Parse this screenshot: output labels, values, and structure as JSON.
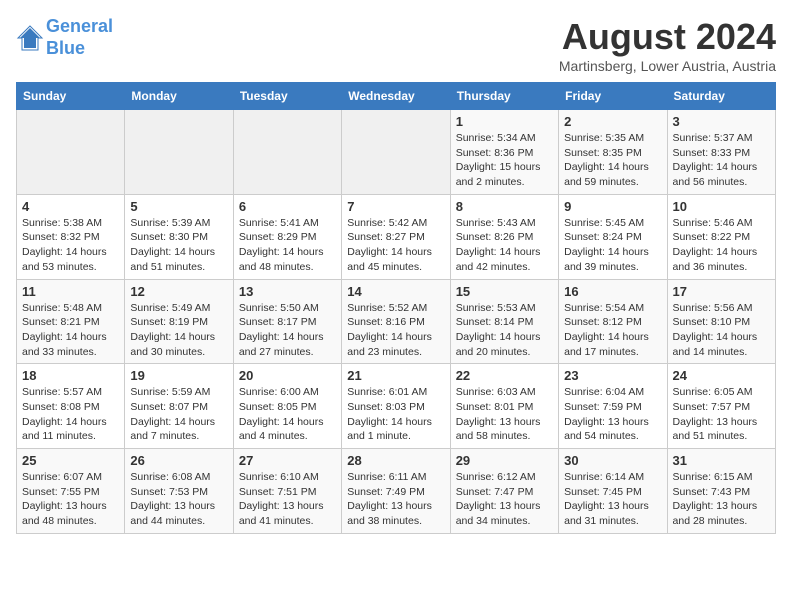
{
  "header": {
    "logo_line1": "General",
    "logo_line2": "Blue",
    "month_year": "August 2024",
    "location": "Martinsberg, Lower Austria, Austria"
  },
  "weekdays": [
    "Sunday",
    "Monday",
    "Tuesday",
    "Wednesday",
    "Thursday",
    "Friday",
    "Saturday"
  ],
  "weeks": [
    [
      {
        "day": "",
        "info": ""
      },
      {
        "day": "",
        "info": ""
      },
      {
        "day": "",
        "info": ""
      },
      {
        "day": "",
        "info": ""
      },
      {
        "day": "1",
        "info": "Sunrise: 5:34 AM\nSunset: 8:36 PM\nDaylight: 15 hours\nand 2 minutes."
      },
      {
        "day": "2",
        "info": "Sunrise: 5:35 AM\nSunset: 8:35 PM\nDaylight: 14 hours\nand 59 minutes."
      },
      {
        "day": "3",
        "info": "Sunrise: 5:37 AM\nSunset: 8:33 PM\nDaylight: 14 hours\nand 56 minutes."
      }
    ],
    [
      {
        "day": "4",
        "info": "Sunrise: 5:38 AM\nSunset: 8:32 PM\nDaylight: 14 hours\nand 53 minutes."
      },
      {
        "day": "5",
        "info": "Sunrise: 5:39 AM\nSunset: 8:30 PM\nDaylight: 14 hours\nand 51 minutes."
      },
      {
        "day": "6",
        "info": "Sunrise: 5:41 AM\nSunset: 8:29 PM\nDaylight: 14 hours\nand 48 minutes."
      },
      {
        "day": "7",
        "info": "Sunrise: 5:42 AM\nSunset: 8:27 PM\nDaylight: 14 hours\nand 45 minutes."
      },
      {
        "day": "8",
        "info": "Sunrise: 5:43 AM\nSunset: 8:26 PM\nDaylight: 14 hours\nand 42 minutes."
      },
      {
        "day": "9",
        "info": "Sunrise: 5:45 AM\nSunset: 8:24 PM\nDaylight: 14 hours\nand 39 minutes."
      },
      {
        "day": "10",
        "info": "Sunrise: 5:46 AM\nSunset: 8:22 PM\nDaylight: 14 hours\nand 36 minutes."
      }
    ],
    [
      {
        "day": "11",
        "info": "Sunrise: 5:48 AM\nSunset: 8:21 PM\nDaylight: 14 hours\nand 33 minutes."
      },
      {
        "day": "12",
        "info": "Sunrise: 5:49 AM\nSunset: 8:19 PM\nDaylight: 14 hours\nand 30 minutes."
      },
      {
        "day": "13",
        "info": "Sunrise: 5:50 AM\nSunset: 8:17 PM\nDaylight: 14 hours\nand 27 minutes."
      },
      {
        "day": "14",
        "info": "Sunrise: 5:52 AM\nSunset: 8:16 PM\nDaylight: 14 hours\nand 23 minutes."
      },
      {
        "day": "15",
        "info": "Sunrise: 5:53 AM\nSunset: 8:14 PM\nDaylight: 14 hours\nand 20 minutes."
      },
      {
        "day": "16",
        "info": "Sunrise: 5:54 AM\nSunset: 8:12 PM\nDaylight: 14 hours\nand 17 minutes."
      },
      {
        "day": "17",
        "info": "Sunrise: 5:56 AM\nSunset: 8:10 PM\nDaylight: 14 hours\nand 14 minutes."
      }
    ],
    [
      {
        "day": "18",
        "info": "Sunrise: 5:57 AM\nSunset: 8:08 PM\nDaylight: 14 hours\nand 11 minutes."
      },
      {
        "day": "19",
        "info": "Sunrise: 5:59 AM\nSunset: 8:07 PM\nDaylight: 14 hours\nand 7 minutes."
      },
      {
        "day": "20",
        "info": "Sunrise: 6:00 AM\nSunset: 8:05 PM\nDaylight: 14 hours\nand 4 minutes."
      },
      {
        "day": "21",
        "info": "Sunrise: 6:01 AM\nSunset: 8:03 PM\nDaylight: 14 hours\nand 1 minute."
      },
      {
        "day": "22",
        "info": "Sunrise: 6:03 AM\nSunset: 8:01 PM\nDaylight: 13 hours\nand 58 minutes."
      },
      {
        "day": "23",
        "info": "Sunrise: 6:04 AM\nSunset: 7:59 PM\nDaylight: 13 hours\nand 54 minutes."
      },
      {
        "day": "24",
        "info": "Sunrise: 6:05 AM\nSunset: 7:57 PM\nDaylight: 13 hours\nand 51 minutes."
      }
    ],
    [
      {
        "day": "25",
        "info": "Sunrise: 6:07 AM\nSunset: 7:55 PM\nDaylight: 13 hours\nand 48 minutes."
      },
      {
        "day": "26",
        "info": "Sunrise: 6:08 AM\nSunset: 7:53 PM\nDaylight: 13 hours\nand 44 minutes."
      },
      {
        "day": "27",
        "info": "Sunrise: 6:10 AM\nSunset: 7:51 PM\nDaylight: 13 hours\nand 41 minutes."
      },
      {
        "day": "28",
        "info": "Sunrise: 6:11 AM\nSunset: 7:49 PM\nDaylight: 13 hours\nand 38 minutes."
      },
      {
        "day": "29",
        "info": "Sunrise: 6:12 AM\nSunset: 7:47 PM\nDaylight: 13 hours\nand 34 minutes."
      },
      {
        "day": "30",
        "info": "Sunrise: 6:14 AM\nSunset: 7:45 PM\nDaylight: 13 hours\nand 31 minutes."
      },
      {
        "day": "31",
        "info": "Sunrise: 6:15 AM\nSunset: 7:43 PM\nDaylight: 13 hours\nand 28 minutes."
      }
    ]
  ]
}
